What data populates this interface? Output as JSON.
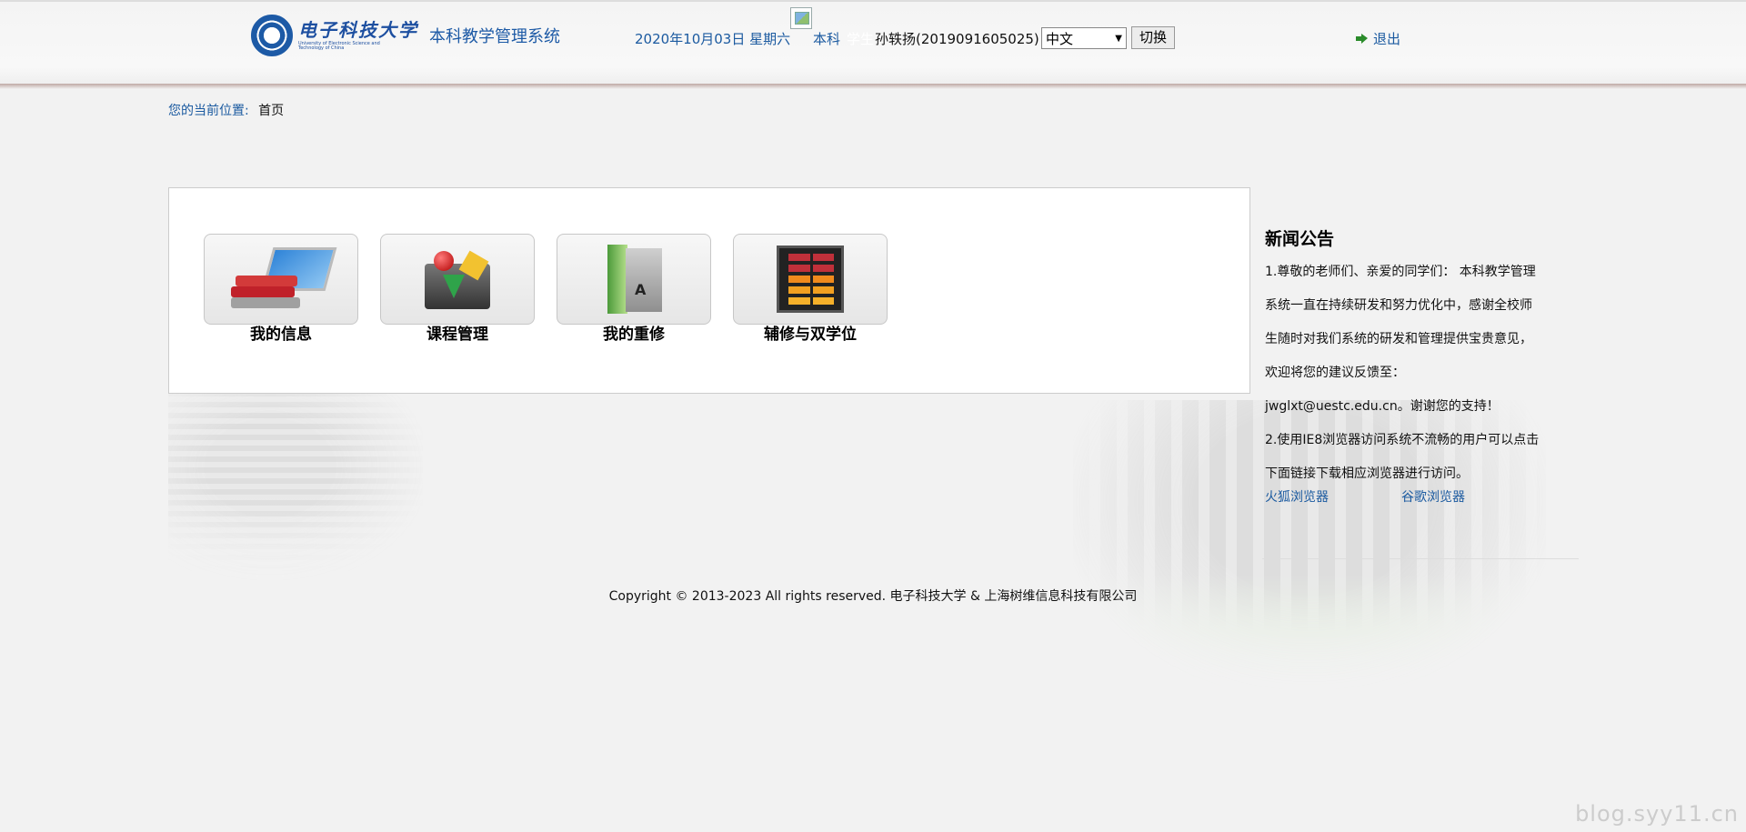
{
  "header": {
    "logo_cn": "电子科技大学",
    "logo_en": "University of Electronic Science and Technology of China",
    "system_title": "本科教学管理系统",
    "date": "2020年10月03日 星期六",
    "level": "本科",
    "role": "学生",
    "user": "孙轶扬(2019091605025)",
    "language": "中文",
    "switch_label": "切换",
    "logout_label": "退出"
  },
  "breadcrumb": {
    "label": "您的当前位置:",
    "current": "首页"
  },
  "tiles": [
    {
      "label": "我的信息",
      "icon": "books-laptop-icon"
    },
    {
      "label": "课程管理",
      "icon": "course-blocks-icon"
    },
    {
      "label": "我的重修",
      "icon": "retake-book-icon"
    },
    {
      "label": "辅修与双学位",
      "icon": "minor-grid-icon"
    }
  ],
  "news": {
    "title": "新闻公告",
    "lines": [
      "1.尊敬的老师们、亲爱的同学们： 本科教学管理",
      "系统一直在持续研发和努力优化中，感谢全校师",
      "生随时对我们系统的研发和管理提供宝贵意见，",
      "欢迎将您的建议反馈至：",
      "jwglxt@uestc.edu.cn。谢谢您的支持！",
      "2.使用IE8浏览器访问系统不流畅的用户可以点击",
      "下面链接下载相应浏览器进行访问。"
    ],
    "link_firefox": "火狐浏览器",
    "link_chrome": "谷歌浏览器"
  },
  "footer": {
    "copyright": "Copyright © 2013-2023 All rights reserved.  电子科技大学 & 上海树维信息科技有限公司"
  },
  "watermark": "blog.syy11.cn",
  "colors": {
    "link_blue": "#1b5aa0",
    "background": "#f2f2f2"
  }
}
